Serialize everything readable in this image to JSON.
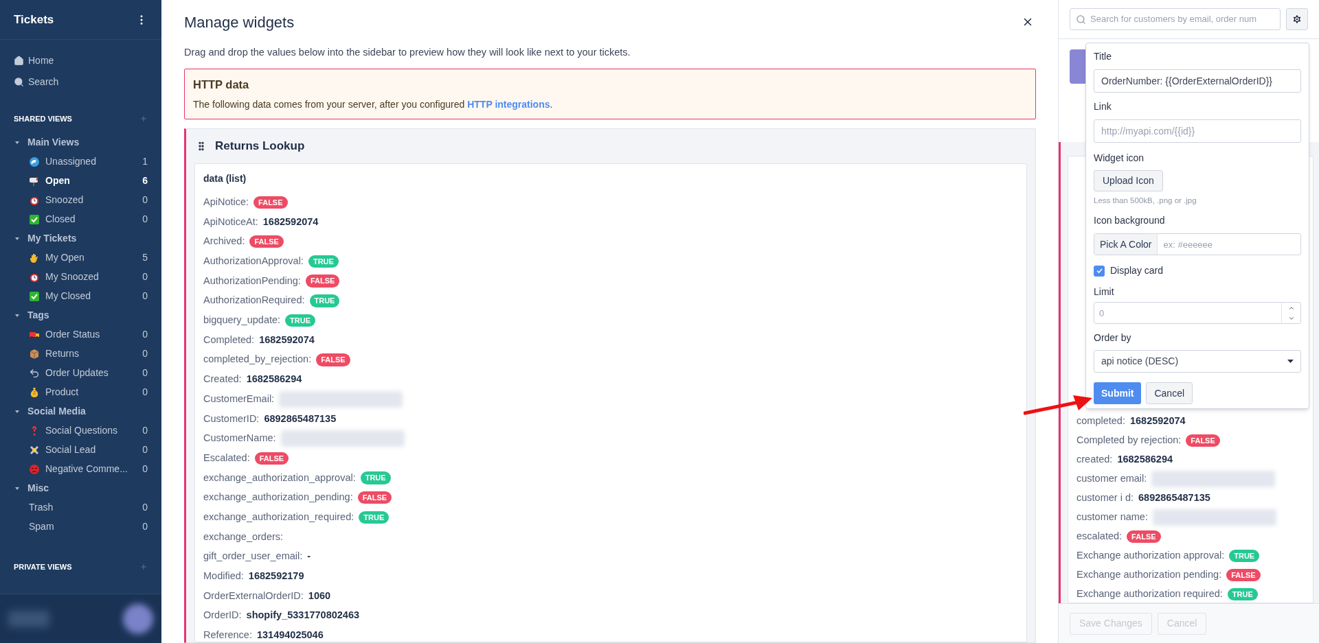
{
  "sidebar": {
    "title": "Tickets",
    "nav": [
      {
        "label": "Home"
      },
      {
        "label": "Search"
      }
    ],
    "shared_views": {
      "heading": "SHARED VIEWS",
      "groups": [
        {
          "label": "Main Views",
          "expanded": true,
          "items": [
            {
              "label": "Unassigned",
              "count": "1",
              "selected": false
            },
            {
              "label": "Open",
              "count": "6",
              "selected": true
            },
            {
              "label": "Snoozed",
              "count": "0",
              "selected": false
            },
            {
              "label": "Closed",
              "count": "0",
              "selected": false
            }
          ]
        },
        {
          "label": "My Tickets",
          "expanded": true,
          "items": [
            {
              "label": "My Open",
              "count": "5",
              "selected": false
            },
            {
              "label": "My Snoozed",
              "count": "0",
              "selected": false
            },
            {
              "label": "My Closed",
              "count": "0",
              "selected": false
            }
          ]
        },
        {
          "label": "Tags",
          "expanded": true,
          "items": [
            {
              "label": "Order Status",
              "count": "0",
              "selected": false
            },
            {
              "label": "Returns",
              "count": "0",
              "selected": false
            },
            {
              "label": "Order Updates",
              "count": "0",
              "selected": false
            },
            {
              "label": "Product",
              "count": "0",
              "selected": false
            }
          ]
        },
        {
          "label": "Social Media",
          "expanded": true,
          "items": [
            {
              "label": "Social Questions",
              "count": "0",
              "selected": false
            },
            {
              "label": "Social Lead",
              "count": "0",
              "selected": false
            },
            {
              "label": "Negative Comme...",
              "count": "0",
              "selected": false
            }
          ]
        },
        {
          "label": "Misc",
          "expanded": true,
          "items": [
            {
              "label": "Trash",
              "count": "0",
              "selected": false
            },
            {
              "label": "Spam",
              "count": "0",
              "selected": false
            }
          ]
        }
      ]
    },
    "private_views": {
      "heading": "PRIVATE VIEWS"
    }
  },
  "dialog": {
    "title": "Manage widgets",
    "description": "Drag and drop the values below into the sidebar to preview how they will look like next to your tickets.",
    "notice": {
      "title": "HTTP data",
      "text": "The following data comes from your server, after you configured ",
      "link": "HTTP integrations",
      "end": "."
    },
    "widget": {
      "title": "Returns Lookup",
      "list_title": "data (list)",
      "rows": [
        {
          "key": "ApiNotice:",
          "kind": "badge",
          "on": false,
          "value": "FALSE"
        },
        {
          "key": "ApiNoticeAt:",
          "kind": "text",
          "value": "1682592074"
        },
        {
          "key": "Archived:",
          "kind": "badge",
          "on": false,
          "value": "FALSE"
        },
        {
          "key": "AuthorizationApproval:",
          "kind": "badge",
          "on": true,
          "value": "TRUE"
        },
        {
          "key": "AuthorizationPending:",
          "kind": "badge",
          "on": false,
          "value": "FALSE"
        },
        {
          "key": "AuthorizationRequired:",
          "kind": "badge",
          "on": true,
          "value": "TRUE"
        },
        {
          "key": "bigquery_update:",
          "kind": "badge",
          "on": true,
          "value": "TRUE"
        },
        {
          "key": "Completed:",
          "kind": "text",
          "value": "1682592074"
        },
        {
          "key": "completed_by_rejection:",
          "kind": "badge",
          "on": false,
          "value": "FALSE"
        },
        {
          "key": "Created:",
          "kind": "text",
          "value": "1682586294"
        },
        {
          "key": "CustomerEmail:",
          "kind": "redacted"
        },
        {
          "key": "CustomerID:",
          "kind": "text",
          "value": "6892865487135"
        },
        {
          "key": "CustomerName:",
          "kind": "redacted"
        },
        {
          "key": "Escalated:",
          "kind": "badge",
          "on": false,
          "value": "FALSE"
        },
        {
          "key": "exchange_authorization_approval:",
          "kind": "badge",
          "on": true,
          "value": "TRUE"
        },
        {
          "key": "exchange_authorization_pending:",
          "kind": "badge",
          "on": false,
          "value": "FALSE"
        },
        {
          "key": "exchange_authorization_required:",
          "kind": "badge",
          "on": true,
          "value": "TRUE"
        },
        {
          "key": "exchange_orders:",
          "kind": "empty"
        },
        {
          "key": "gift_order_user_email:",
          "kind": "text",
          "value": "-"
        },
        {
          "key": "Modified:",
          "kind": "text",
          "value": "1682592179"
        },
        {
          "key": "OrderExternalOrderID:",
          "kind": "text",
          "value": "1060"
        },
        {
          "key": "OrderID:",
          "kind": "text",
          "value": "shopify_5331770802463"
        },
        {
          "key": "Reference:",
          "kind": "text",
          "value": "131494025046"
        }
      ]
    }
  },
  "preview": {
    "search": {
      "placeholder": "Search for customers by email, order num"
    },
    "rows": [
      {
        "key": "completed:",
        "kind": "text",
        "value": "1682592074"
      },
      {
        "key": "Completed by rejection:",
        "kind": "badge",
        "on": false,
        "value": "FALSE"
      },
      {
        "key": "created:",
        "kind": "text",
        "value": "1682586294"
      },
      {
        "key": "customer email:",
        "kind": "redacted"
      },
      {
        "key": "customer i d:",
        "kind": "text",
        "value": "6892865487135"
      },
      {
        "key": "customer name:",
        "kind": "redacted"
      },
      {
        "key": "escalated:",
        "kind": "badge",
        "on": false,
        "value": "FALSE"
      },
      {
        "key": "Exchange authorization approval:",
        "kind": "badge",
        "on": true,
        "value": "TRUE"
      },
      {
        "key": "Exchange authorization pending:",
        "kind": "badge",
        "on": false,
        "value": "FALSE"
      },
      {
        "key": "Exchange authorization required:",
        "kind": "badge",
        "on": true,
        "value": "TRUE"
      }
    ],
    "buttons": [
      {
        "label": "Save Changes",
        "disabled": true
      },
      {
        "label": "Cancel",
        "disabled": true
      }
    ]
  },
  "popover": {
    "title_label": "Title",
    "title_value": "OrderNumber: {{OrderExternalOrderID}}",
    "link_label": "Link",
    "link_placeholder": "http://myapi.com/{{id}}",
    "icon_label": "Widget icon",
    "upload_button": "Upload Icon",
    "upload_hint": "Less than 500kB, .png or .jpg",
    "bg_label": "Icon background",
    "pick_button": "Pick A Color",
    "bg_placeholder": "ex: #eeeeee",
    "display_card": {
      "label": "Display card",
      "checked": true
    },
    "limit_label": "Limit",
    "limit_placeholder": "0",
    "order_label": "Order by",
    "order_value": "api notice (DESC)",
    "submit": "Submit",
    "cancel": "Cancel"
  }
}
